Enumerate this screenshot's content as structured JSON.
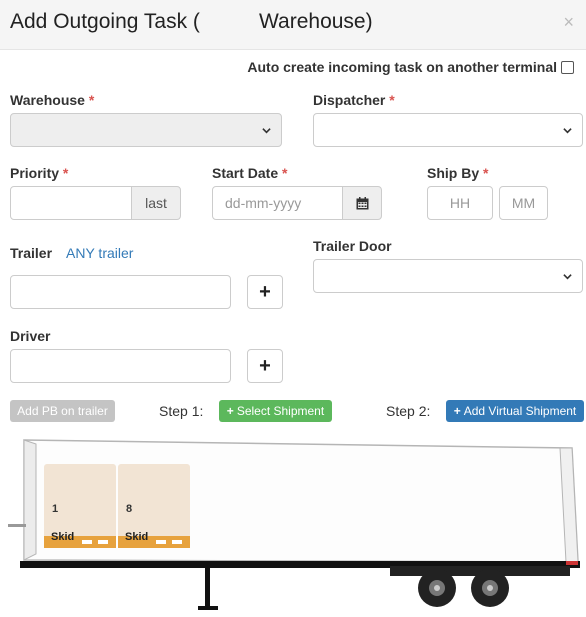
{
  "header": {
    "title_part1": "Add Outgoing Task (",
    "title_part2": "Warehouse)",
    "close": "×"
  },
  "auto_create": {
    "label": "Auto create incoming task on another terminal",
    "checked": false
  },
  "form": {
    "warehouse": {
      "label": "Warehouse",
      "required": "*",
      "value": ""
    },
    "dispatcher": {
      "label": "Dispatcher",
      "required": "*",
      "value": ""
    },
    "priority": {
      "label": "Priority",
      "required": "*",
      "value": "",
      "addon": "last"
    },
    "start_date": {
      "label": "Start Date",
      "required": "*",
      "placeholder": "dd-mm-yyyy"
    },
    "ship_by": {
      "label": "Ship By",
      "required": "*",
      "hh_placeholder": "HH",
      "mm_placeholder": "MM"
    },
    "trailer": {
      "label": "Trailer",
      "link": "ANY trailer",
      "value": ""
    },
    "trailer_door": {
      "label": "Trailer Door",
      "value": ""
    },
    "driver": {
      "label": "Driver",
      "value": ""
    },
    "plus": "+"
  },
  "actions": {
    "add_pb": "Add PB on trailer",
    "step1": "Step 1:",
    "select_shipment": "Select Shipment",
    "step2": "Step 2:",
    "add_virtual": "Add Virtual Shipment",
    "plus": "+"
  },
  "skids": [
    {
      "number": "1",
      "label": "Skid"
    },
    {
      "number": "8",
      "label": "Skid"
    }
  ],
  "colors": {
    "required": "#d9534f",
    "link": "#337ab7",
    "green": "#5cb85c",
    "blue": "#337ab7",
    "skid": "#f2e4d4",
    "pallet": "#e7a23d"
  }
}
